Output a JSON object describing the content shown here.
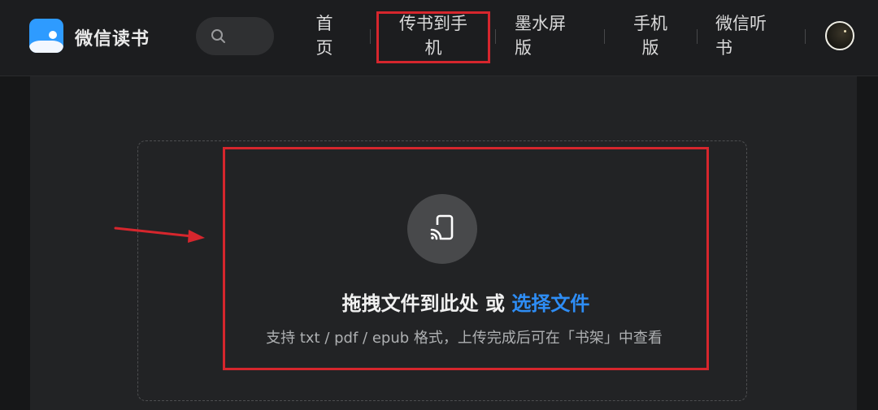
{
  "header": {
    "brand": "微信读书",
    "nav": [
      {
        "label": "首\n页"
      },
      {
        "label": "传书到手\n机"
      },
      {
        "label": "墨水屏\n版"
      },
      {
        "label": "手机\n版"
      },
      {
        "label": "微信听\n书"
      }
    ]
  },
  "upload": {
    "title_prefix": "拖拽文件到此处 或 ",
    "select_label": "选择文件",
    "hint": "支持 txt / pdf / epub 格式，上传完成后可在「书架」中查看"
  },
  "icons": {
    "logo": "book-logo-icon",
    "search": "search-icon",
    "upload": "cast-to-phone-icon",
    "avatar": "user-avatar"
  },
  "colors": {
    "accent": "#2e8df5",
    "highlight": "#d6262d",
    "background": "#161718"
  }
}
